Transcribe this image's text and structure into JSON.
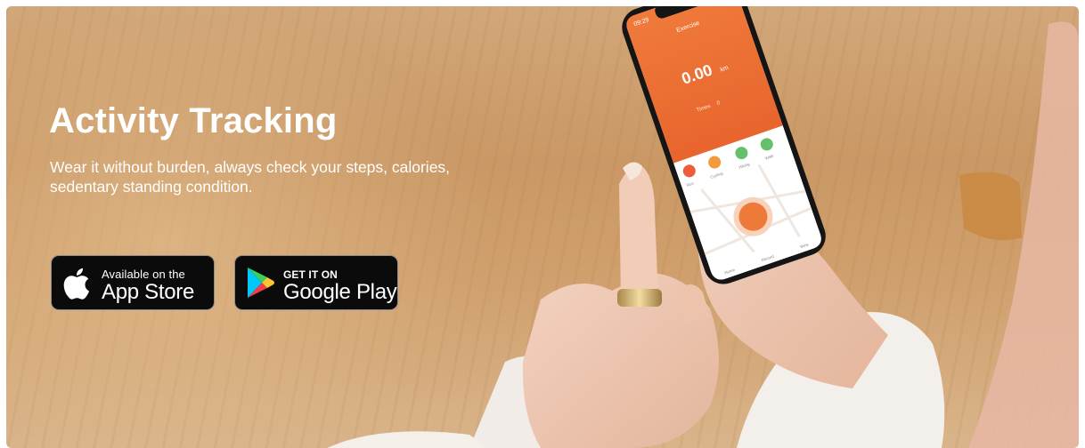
{
  "hero": {
    "title": "Activity Tracking",
    "subtitle": "Wear it without burden, always check your steps, calories, sedentary standing condition."
  },
  "phone": {
    "time": "09:29",
    "screen_title": "Exercise",
    "distance_value": "0.00",
    "distance_unit": "km",
    "times_label": "Times",
    "times_value": "0",
    "modes": [
      "Run",
      "Cycling",
      "Hiking",
      "Walk"
    ],
    "nav_items": [
      "Home",
      "Record",
      "Mine"
    ]
  },
  "stores": {
    "app_store": {
      "small": "Available on the",
      "big": "App Store",
      "icon": "apple-logo-icon"
    },
    "google_play": {
      "small": "GET IT ON",
      "big": "Google Play",
      "icon": "google-play-logo-icon"
    }
  },
  "colors": {
    "accent": "#ee7a3a",
    "button_bg": "#0b0b0b"
  }
}
